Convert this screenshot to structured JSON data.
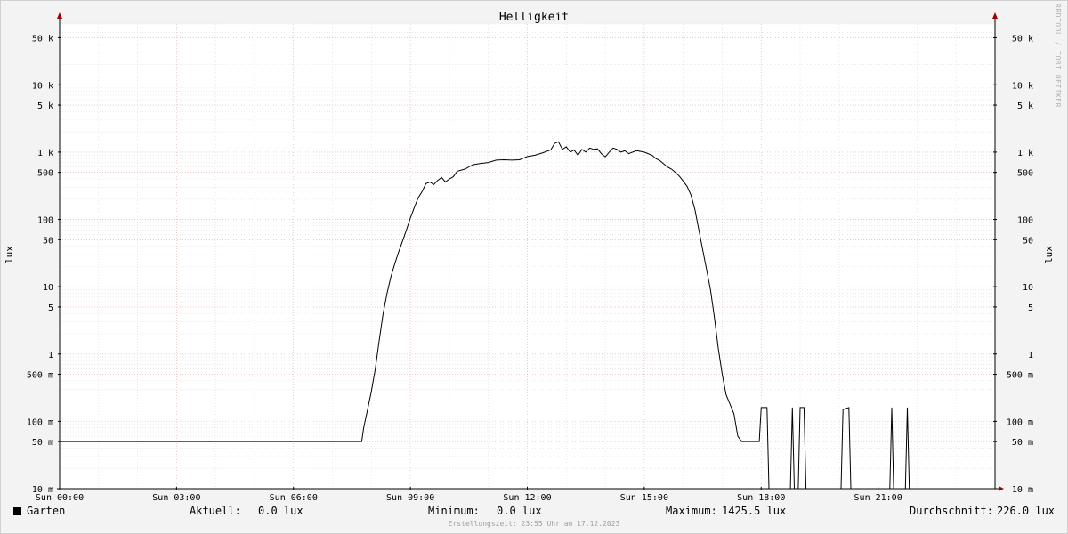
{
  "chart_data": {
    "type": "line",
    "title": "Helligkeit",
    "ylabel": "lux",
    "yscale": "log",
    "ylim": [
      0.01,
      80000
    ],
    "xlim": [
      0,
      24
    ],
    "x_unit": "hours",
    "grid": true,
    "x_ticks": [
      {
        "x": 0,
        "label": "Sun 00:00"
      },
      {
        "x": 3,
        "label": "Sun 03:00"
      },
      {
        "x": 6,
        "label": "Sun 06:00"
      },
      {
        "x": 9,
        "label": "Sun 09:00"
      },
      {
        "x": 12,
        "label": "Sun 12:00"
      },
      {
        "x": 15,
        "label": "Sun 15:00"
      },
      {
        "x": 18,
        "label": "Sun 18:00"
      },
      {
        "x": 21,
        "label": "Sun 21:00"
      }
    ],
    "y_ticks": [
      {
        "y": 0.01,
        "label": "10 m"
      },
      {
        "y": 0.05,
        "label": "50 m"
      },
      {
        "y": 0.1,
        "label": "100 m"
      },
      {
        "y": 0.5,
        "label": "500 m"
      },
      {
        "y": 1,
        "label": "1"
      },
      {
        "y": 5,
        "label": "5"
      },
      {
        "y": 10,
        "label": "10"
      },
      {
        "y": 50,
        "label": "50"
      },
      {
        "y": 100,
        "label": "100"
      },
      {
        "y": 500,
        "label": "500"
      },
      {
        "y": 1000,
        "label": "1 k"
      },
      {
        "y": 5000,
        "label": "5 k"
      },
      {
        "y": 10000,
        "label": "10 k"
      },
      {
        "y": 50000,
        "label": "50 k"
      }
    ],
    "series": [
      {
        "name": "Garten",
        "color": "#000000",
        "points": [
          [
            0.0,
            0.05
          ],
          [
            7.75,
            0.05
          ],
          [
            7.8,
            0.08
          ],
          [
            7.9,
            0.15
          ],
          [
            8.0,
            0.28
          ],
          [
            8.1,
            0.6
          ],
          [
            8.2,
            1.6
          ],
          [
            8.3,
            4.0
          ],
          [
            8.4,
            8.0
          ],
          [
            8.5,
            14
          ],
          [
            8.6,
            22
          ],
          [
            8.7,
            33
          ],
          [
            8.8,
            48
          ],
          [
            8.9,
            70
          ],
          [
            9.0,
            105
          ],
          [
            9.1,
            150
          ],
          [
            9.2,
            210
          ],
          [
            9.3,
            260
          ],
          [
            9.4,
            340
          ],
          [
            9.5,
            360
          ],
          [
            9.6,
            330
          ],
          [
            9.7,
            380
          ],
          [
            9.8,
            420
          ],
          [
            9.9,
            360
          ],
          [
            10.0,
            400
          ],
          [
            10.1,
            430
          ],
          [
            10.2,
            520
          ],
          [
            10.4,
            560
          ],
          [
            10.6,
            650
          ],
          [
            10.8,
            680
          ],
          [
            11.0,
            700
          ],
          [
            11.2,
            760
          ],
          [
            11.4,
            770
          ],
          [
            11.6,
            760
          ],
          [
            11.8,
            770
          ],
          [
            12.0,
            860
          ],
          [
            12.2,
            900
          ],
          [
            12.4,
            980
          ],
          [
            12.6,
            1080
          ],
          [
            12.7,
            1350
          ],
          [
            12.8,
            1425.5
          ],
          [
            12.9,
            1100
          ],
          [
            13.0,
            1200
          ],
          [
            13.1,
            1000
          ],
          [
            13.2,
            1080
          ],
          [
            13.3,
            900
          ],
          [
            13.4,
            1100
          ],
          [
            13.5,
            1000
          ],
          [
            13.6,
            1150
          ],
          [
            13.7,
            1100
          ],
          [
            13.8,
            1120
          ],
          [
            13.9,
            950
          ],
          [
            14.0,
            850
          ],
          [
            14.1,
            1000
          ],
          [
            14.2,
            1150
          ],
          [
            14.3,
            1100
          ],
          [
            14.4,
            1000
          ],
          [
            14.5,
            1050
          ],
          [
            14.6,
            950
          ],
          [
            14.8,
            1050
          ],
          [
            15.0,
            1000
          ],
          [
            15.2,
            900
          ],
          [
            15.3,
            800
          ],
          [
            15.4,
            750
          ],
          [
            15.5,
            670
          ],
          [
            15.6,
            600
          ],
          [
            15.7,
            560
          ],
          [
            15.8,
            500
          ],
          [
            15.9,
            440
          ],
          [
            16.0,
            370
          ],
          [
            16.1,
            310
          ],
          [
            16.2,
            230
          ],
          [
            16.3,
            140
          ],
          [
            16.4,
            70
          ],
          [
            16.5,
            35
          ],
          [
            16.6,
            18
          ],
          [
            16.7,
            9
          ],
          [
            16.8,
            3.5
          ],
          [
            16.9,
            1.2
          ],
          [
            17.0,
            0.5
          ],
          [
            17.1,
            0.25
          ],
          [
            17.2,
            0.18
          ],
          [
            17.3,
            0.13
          ],
          [
            17.4,
            0.06
          ],
          [
            17.5,
            0.05
          ],
          [
            17.95,
            0.05
          ],
          [
            18.0,
            0.16
          ],
          [
            18.15,
            0.16
          ],
          [
            18.2,
            0.01
          ],
          [
            18.75,
            0.01
          ],
          [
            18.8,
            0.16
          ],
          [
            18.85,
            0.01
          ],
          [
            18.95,
            0.01
          ],
          [
            19.0,
            0.16
          ],
          [
            19.1,
            0.16
          ],
          [
            19.15,
            0.01
          ],
          [
            20.05,
            0.01
          ],
          [
            20.1,
            0.15
          ],
          [
            20.25,
            0.16
          ],
          [
            20.3,
            0.01
          ],
          [
            21.3,
            0.01
          ],
          [
            21.35,
            0.16
          ],
          [
            21.4,
            0.01
          ],
          [
            21.7,
            0.01
          ],
          [
            21.75,
            0.16
          ],
          [
            21.8,
            0.01
          ],
          [
            24.0,
            0.01
          ]
        ]
      }
    ]
  },
  "legend": {
    "series_name": "Garten",
    "swatch_color": "#000000",
    "current_label": "Aktuell:",
    "current_value": "0.0 lux",
    "min_label": "Minimum:",
    "min_value": "0.0 lux",
    "max_label": "Maximum:",
    "max_value": "1425.5 lux",
    "avg_label": "Durchschnitt:",
    "avg_value": "226.0 lux"
  },
  "footer": "Erstellungszeit: 23:55 Uhr am 17.12.2023",
  "watermark": "RRDTOOL / TOBI OETIKER",
  "colors": {
    "background": "#f3f3f3",
    "plot_background": "#ffffff",
    "minor_grid": "#dcdcdc",
    "major_grid": "#e8a8a8",
    "axis_arrow": "#a00000"
  }
}
